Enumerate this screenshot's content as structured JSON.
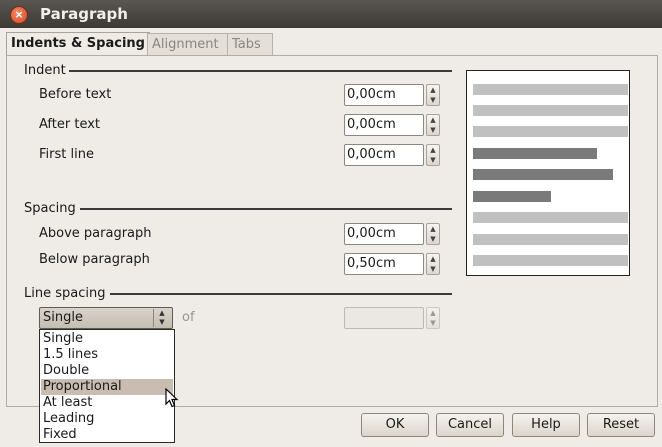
{
  "window": {
    "title": "Paragraph"
  },
  "tabs": [
    {
      "label": "Indents & Spacing",
      "active": true
    },
    {
      "label": "Alignment",
      "active": false
    },
    {
      "label": "Tabs",
      "active": false
    }
  ],
  "indent": {
    "heading": "Indent",
    "before_text": {
      "label": "Before text",
      "value": "0,00cm"
    },
    "after_text": {
      "label": "After text",
      "value": "0,00cm"
    },
    "first_line": {
      "label": "First line",
      "value": "0,00cm"
    }
  },
  "spacing": {
    "heading": "Spacing",
    "above": {
      "label": "Above paragraph",
      "value": "0,00cm"
    },
    "below": {
      "label": "Below paragraph",
      "value": "0,50cm"
    }
  },
  "line_spacing": {
    "heading": "Line spacing",
    "selected": "Single",
    "of_label": "of",
    "of_value": "",
    "options": [
      "Single",
      "1.5 lines",
      "Double",
      "Proportional",
      "At least",
      "Leading",
      "Fixed"
    ],
    "highlighted": "Proportional"
  },
  "buttons": {
    "ok": "OK",
    "cancel": "Cancel",
    "help": "Help",
    "reset": "Reset"
  },
  "colors": {
    "preview_light": "#c0c0c0",
    "preview_dark": "#7a7a7a",
    "highlight": "#c8bdb0"
  }
}
